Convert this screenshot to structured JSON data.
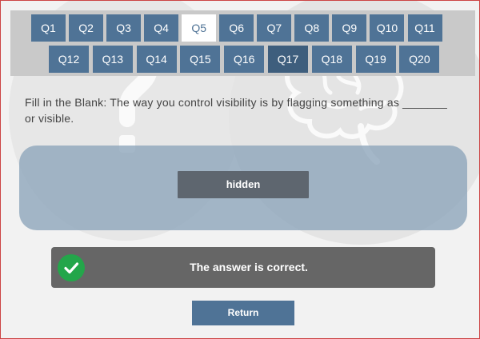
{
  "nav": {
    "questions": [
      "Q1",
      "Q2",
      "Q3",
      "Q4",
      "Q5",
      "Q6",
      "Q7",
      "Q8",
      "Q9",
      "Q10",
      "Q11",
      "Q12",
      "Q13",
      "Q14",
      "Q15",
      "Q16",
      "Q17",
      "Q18",
      "Q19",
      "Q20"
    ],
    "current": "Q5",
    "highlighted": "Q17"
  },
  "question": {
    "text": "Fill in the Blank: The way you control visibility is by flagging something as _______ or visible."
  },
  "answer": {
    "selected": "hidden"
  },
  "feedback": {
    "text": "The answer is correct.",
    "icon": "checkmark-icon",
    "color": "#23a64a"
  },
  "actions": {
    "return_label": "Return"
  },
  "colors": {
    "nav_button": "#4f7396",
    "nav_current": "#ffffff",
    "nav_bar": "#c9c9c9",
    "answer_area": "#8ca4ba",
    "answer_chip": "#5e666f",
    "feedback_bg": "#666666"
  }
}
